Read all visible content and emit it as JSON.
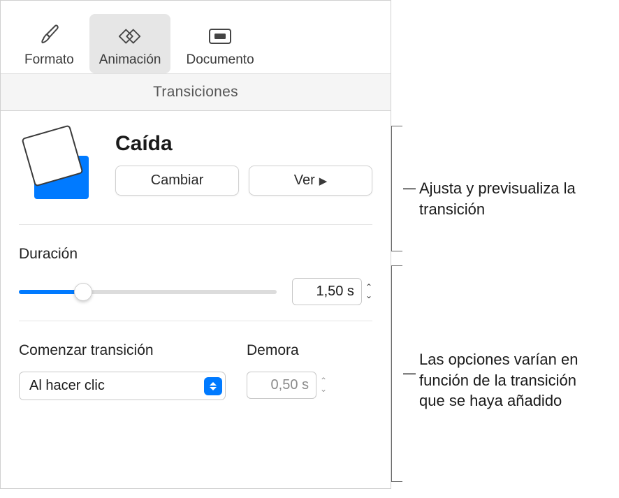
{
  "tabs": {
    "format": {
      "label": "Formato"
    },
    "animation": {
      "label": "Animación"
    },
    "document": {
      "label": "Documento"
    }
  },
  "section_header": "Transiciones",
  "transition": {
    "name": "Caída",
    "change_button": "Cambiar",
    "preview_button": "Ver"
  },
  "duration": {
    "label": "Duración",
    "value": "1,50 s"
  },
  "start": {
    "label": "Comenzar transición",
    "selected": "Al hacer clic"
  },
  "delay": {
    "label": "Demora",
    "value": "0,50 s"
  },
  "callouts": {
    "preview": "Ajusta y previsualiza la transición",
    "options": "Las opciones varían en función de la transición que se haya añadido"
  }
}
